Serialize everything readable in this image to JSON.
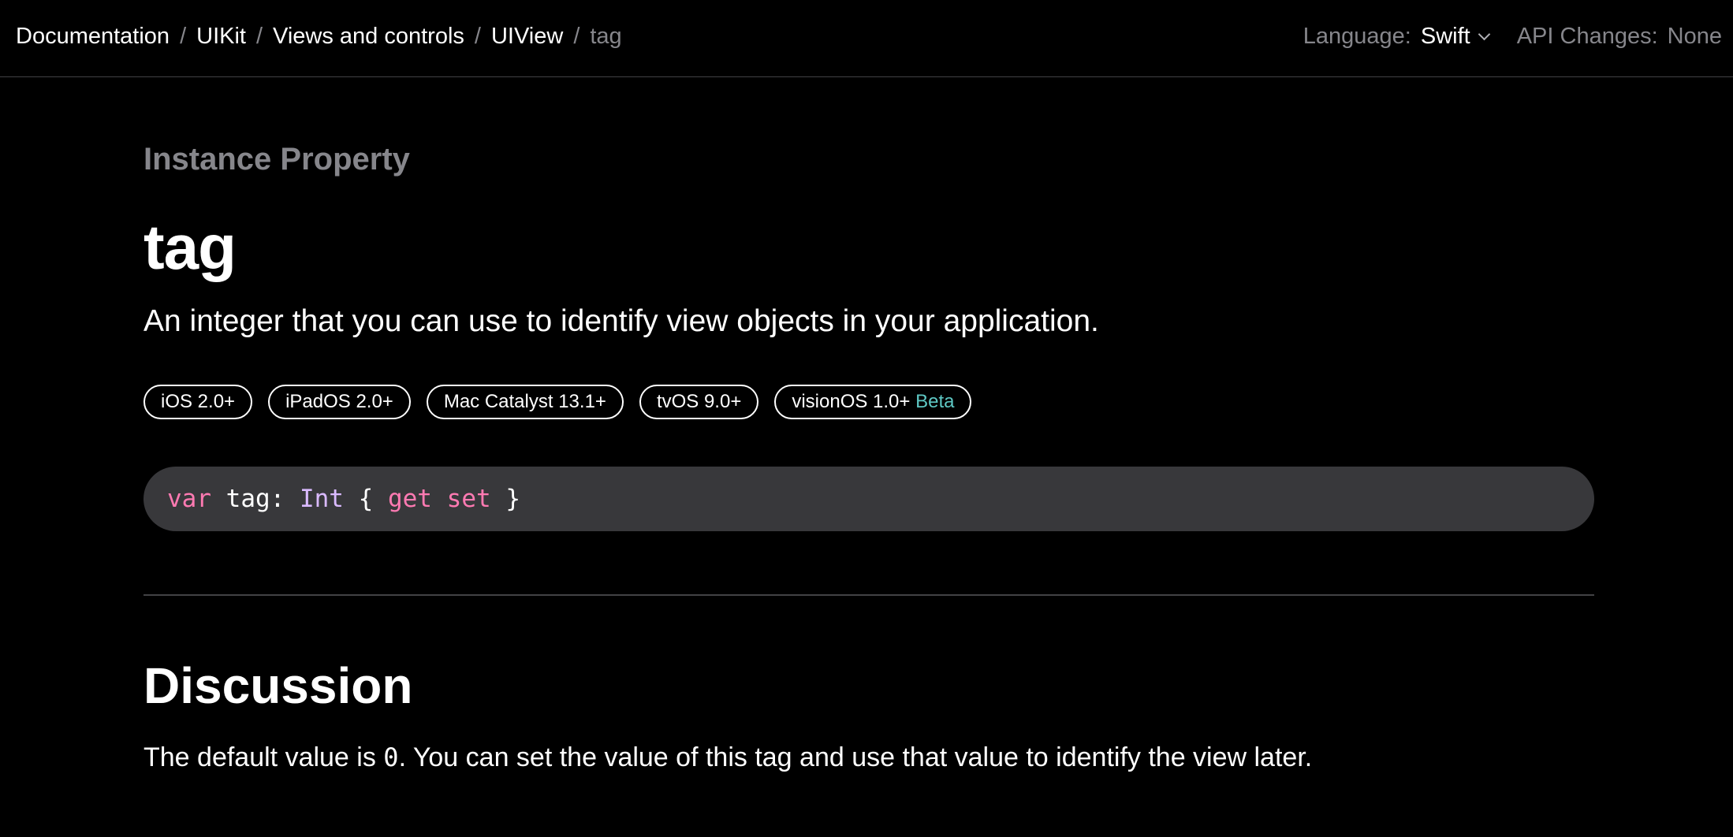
{
  "breadcrumb": {
    "items": [
      "Documentation",
      "UIKit",
      "Views and controls",
      "UIView"
    ],
    "separator": "/",
    "current": "tag"
  },
  "topbar": {
    "language_label": "Language:",
    "language_value": "Swift",
    "api_changes_label": "API Changes:",
    "api_changes_value": "None"
  },
  "page": {
    "eyebrow": "Instance Property",
    "title": "tag",
    "abstract": "An integer that you can use to identify view objects in your application."
  },
  "availability": [
    {
      "label": "iOS 2.0+",
      "beta": ""
    },
    {
      "label": "iPadOS 2.0+",
      "beta": ""
    },
    {
      "label": "Mac Catalyst 13.1+",
      "beta": ""
    },
    {
      "label": "tvOS 9.0+",
      "beta": ""
    },
    {
      "label": "visionOS 1.0+",
      "beta": "Beta"
    }
  ],
  "declaration": {
    "kw_var": "var",
    "name": " tag: ",
    "type": "Int",
    "brace_open": " { ",
    "kw_get": "get",
    "space": " ",
    "kw_set": "set",
    "brace_close": " }"
  },
  "discussion": {
    "heading": "Discussion",
    "text_before": "The default value is ",
    "code": "0",
    "text_after": ". You can set the value of this tag and use that value to identify the view later."
  },
  "colors": {
    "background": "#000000",
    "text": "#ffffff",
    "muted": "#86868b",
    "code_background": "#38383b",
    "keyword": "#ff7ab2",
    "type": "#dabaff",
    "beta": "#5ec8c4"
  }
}
